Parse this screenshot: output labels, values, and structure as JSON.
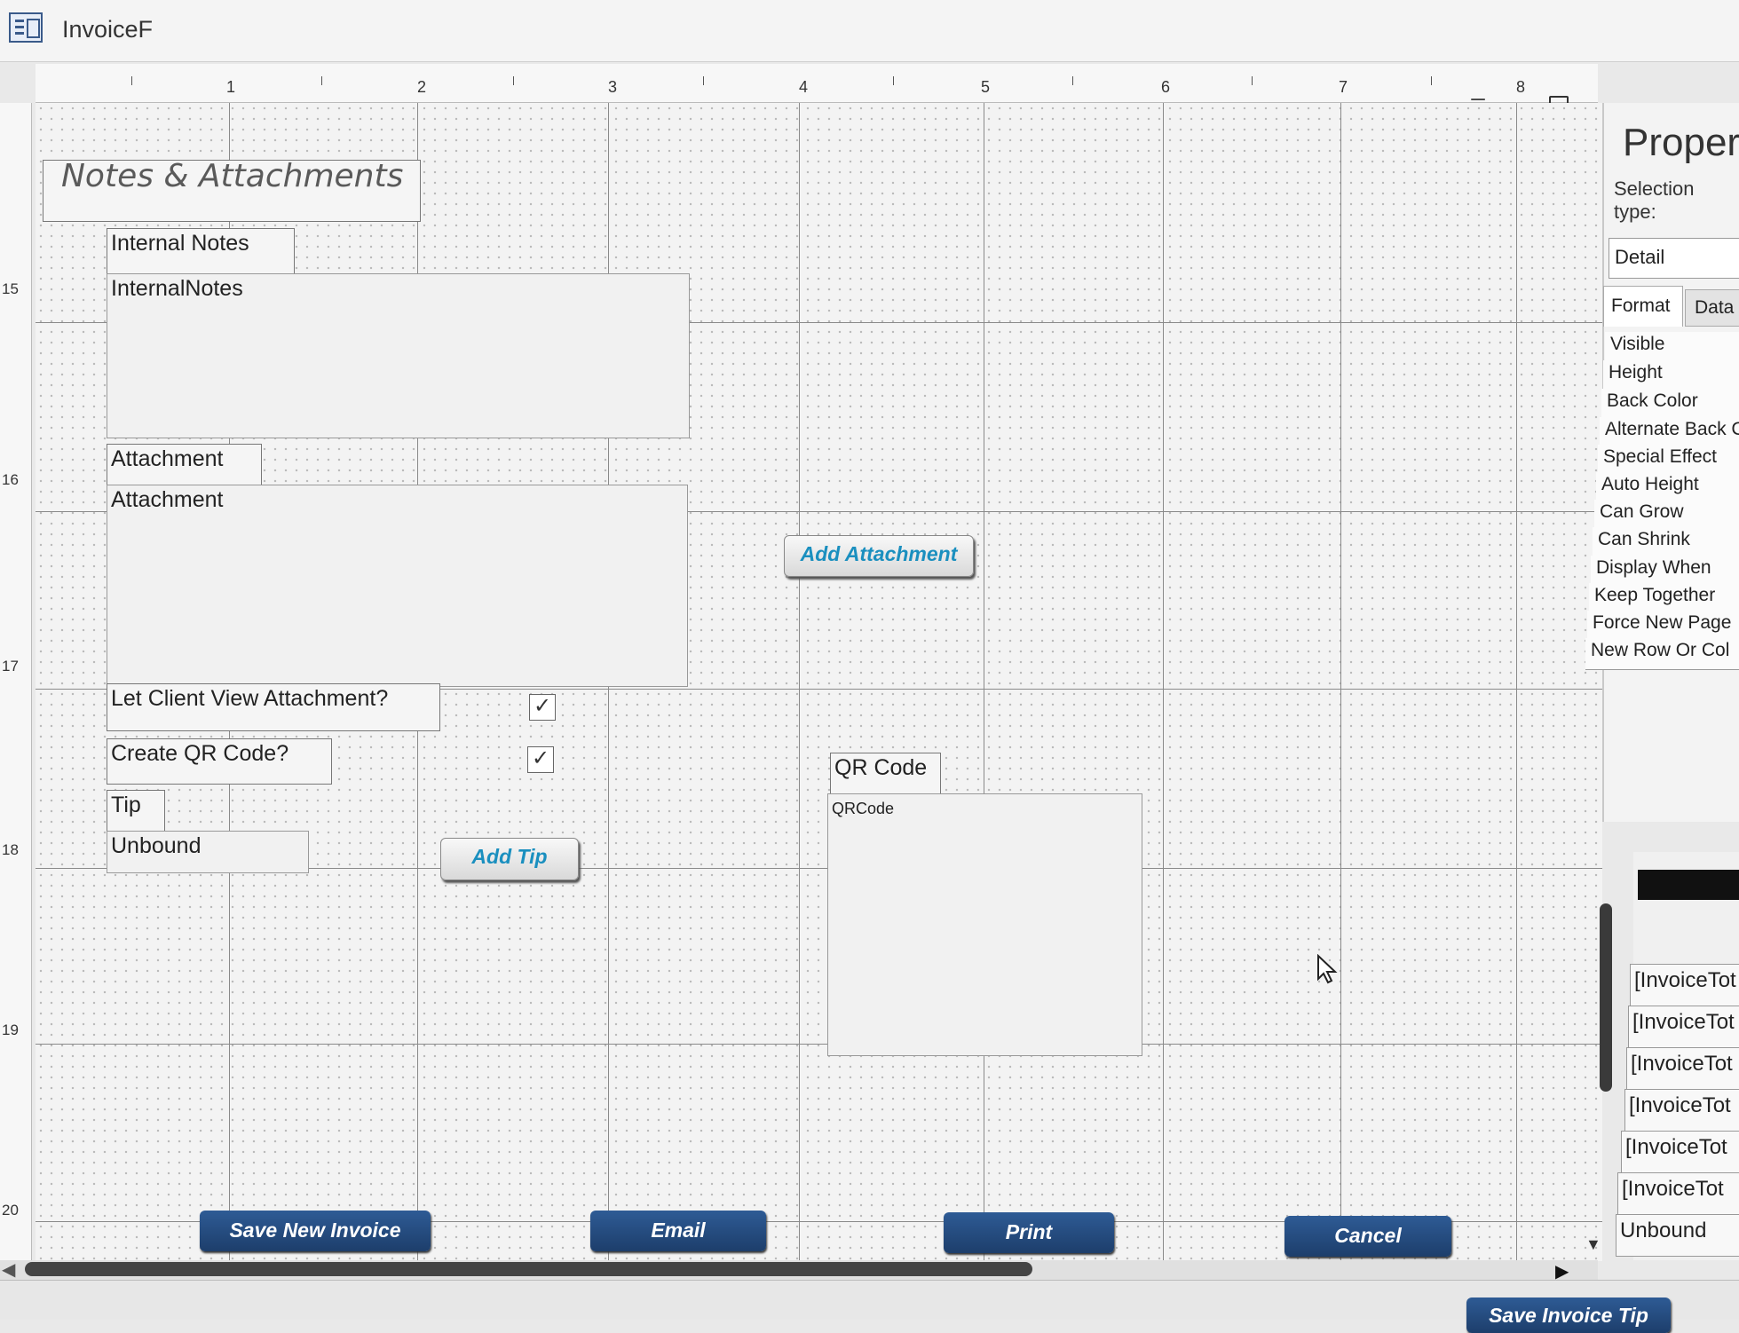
{
  "window": {
    "title": "InvoiceF",
    "icon": "form-icon"
  },
  "ruler": {
    "marks": [
      "1",
      "2",
      "3",
      "4",
      "5",
      "6",
      "7",
      "8"
    ]
  },
  "vruler": {
    "marks": [
      "15",
      "16",
      "17",
      "18",
      "19",
      "20"
    ]
  },
  "form": {
    "heading": "Notes & Attachments",
    "internal_notes_label": "Internal Notes",
    "internal_notes_field": "InternalNotes",
    "attachment_label": "Attachment",
    "attachment_field": "Attachment",
    "add_attachment_button": "Add Attachment",
    "let_client_view_label": "Let Client View Attachment?",
    "let_client_view_checked": "✓",
    "create_qr_label": "Create QR Code?",
    "create_qr_checked": "✓",
    "qr_code_label": "QR Code",
    "qr_code_field": "QRCode",
    "tip_label": "Tip",
    "tip_field": "Unbound",
    "add_tip_button": "Add Tip",
    "save_new_invoice_button": "Save New Invoice",
    "email_button": "Email",
    "print_button": "Print",
    "cancel_button": "Cancel"
  },
  "properties": {
    "title": "Proper",
    "selection_type_label": "Selection type:",
    "selection_value": "Detail",
    "tabs": [
      "Format",
      "Data"
    ],
    "rows": [
      "Visible",
      "Height",
      "Back Color",
      "Alternate Back C",
      "Special Effect",
      "Auto Height",
      "Can Grow",
      "Can Shrink",
      "Display When",
      "Keep Together",
      "Force New Page",
      "New Row Or Col"
    ]
  },
  "field_list": {
    "rows": [
      "[InvoiceTot",
      "[InvoiceTot",
      "[InvoiceTot",
      "[InvoiceTot",
      "[InvoiceTot",
      "[InvoiceTot",
      "Unbound"
    ]
  },
  "bottom": {
    "save_invoice_tip_button": "Save Invoice Tip"
  },
  "colors": {
    "button_blue": "#1d3e6b",
    "link_teal": "#1a8fbf",
    "grid": "#8a8a8a"
  }
}
